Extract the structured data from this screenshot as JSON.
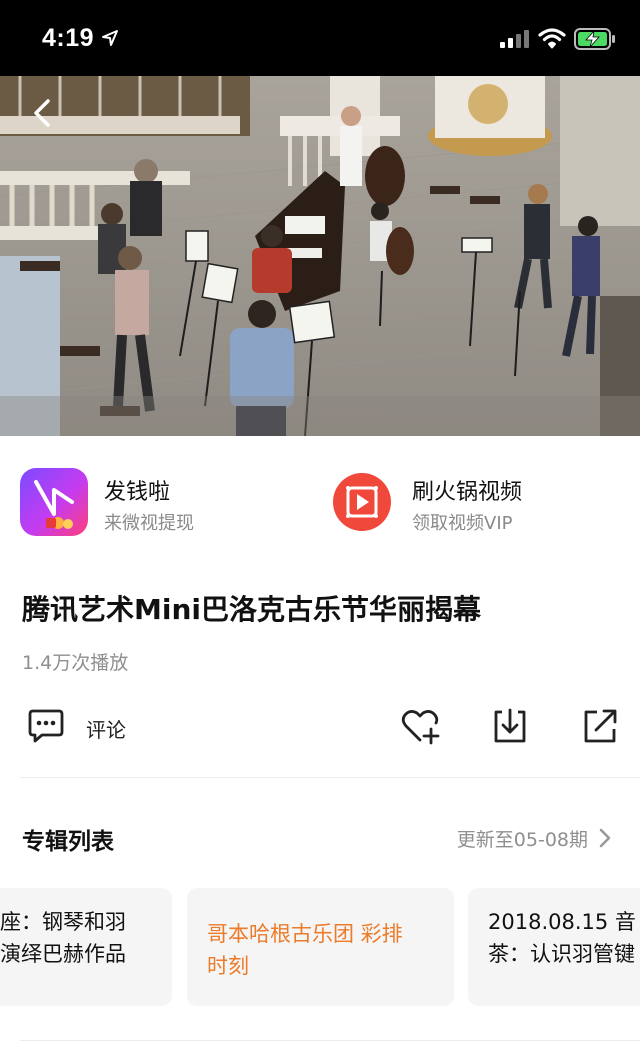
{
  "status_bar": {
    "time": "4:19"
  },
  "promos": [
    {
      "title": "发钱啦",
      "subtitle": "来微视提现",
      "icon": "weishi-app-icon"
    },
    {
      "title": "刷火锅视频",
      "subtitle": "领取视频VIP",
      "icon": "tencent-video-app-icon"
    }
  ],
  "video": {
    "title": "腾讯艺术Mini巴洛克古乐节华丽揭幕",
    "play_count": "1.4万次播放"
  },
  "actions": {
    "comment_label": "评论"
  },
  "album": {
    "title": "专辑列表",
    "update": "更新至05-08期",
    "episodes": [
      {
        "line1": "座：钢琴和羽",
        "line2": "演绎巴赫作品"
      },
      {
        "line1": "哥本哈根古乐团 彩排",
        "line2": "时刻"
      },
      {
        "line1": "2018.08.15 音",
        "line2": "茶：认识羽管键"
      }
    ]
  },
  "colors": {
    "accent_orange": "#ec7b2a",
    "text_gray": "#8f8f8f",
    "card_bg": "#f5f5f5"
  }
}
